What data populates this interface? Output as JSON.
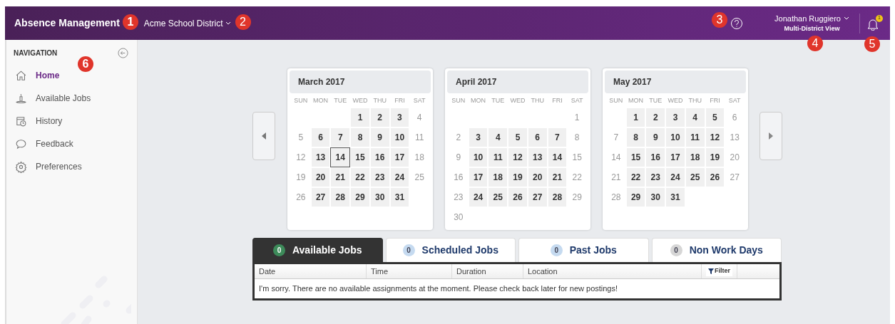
{
  "header": {
    "title": {
      "text": "Absence Management",
      "callout": "1"
    },
    "district": {
      "text": "Acme School District",
      "callout": "2"
    },
    "help": {
      "callout": "3"
    },
    "user": {
      "name": "Jonathan Ruggiero",
      "view": "Multi-District View",
      "callout": "4"
    },
    "notifications": {
      "count": "1",
      "callout": "5"
    }
  },
  "sidebar": {
    "heading": "NAVIGATION",
    "callout": "6",
    "items": [
      {
        "label": "Home",
        "kind": "home",
        "selected": true
      },
      {
        "label": "Available Jobs",
        "kind": "jobs",
        "selected": false
      },
      {
        "label": "History",
        "kind": "history",
        "selected": false
      },
      {
        "label": "Feedback",
        "kind": "feedback",
        "selected": false
      },
      {
        "label": "Preferences",
        "kind": "preferences",
        "selected": false
      }
    ]
  },
  "months": [
    {
      "title": "March 2017",
      "weekdays": [
        "SUN",
        "MON",
        "TUE",
        "WED",
        "THU",
        "FRI",
        "SAT"
      ],
      "weeks": [
        [
          {
            "kind": "blank"
          },
          {
            "kind": "blank"
          },
          {
            "kind": "blank"
          },
          {
            "day": "1",
            "kind": "workday"
          },
          {
            "day": "2",
            "kind": "workday"
          },
          {
            "day": "3",
            "kind": "workday"
          },
          {
            "day": "4",
            "kind": "weekend"
          }
        ],
        [
          {
            "day": "5",
            "kind": "weekend"
          },
          {
            "day": "6",
            "kind": "workday"
          },
          {
            "day": "7",
            "kind": "workday"
          },
          {
            "day": "8",
            "kind": "workday"
          },
          {
            "day": "9",
            "kind": "workday"
          },
          {
            "day": "10",
            "kind": "workday"
          },
          {
            "day": "11",
            "kind": "weekend"
          }
        ],
        [
          {
            "day": "12",
            "kind": "weekend"
          },
          {
            "day": "13",
            "kind": "workday"
          },
          {
            "day": "14",
            "kind": "today"
          },
          {
            "day": "15",
            "kind": "workday"
          },
          {
            "day": "16",
            "kind": "workday"
          },
          {
            "day": "17",
            "kind": "workday"
          },
          {
            "day": "18",
            "kind": "weekend"
          }
        ],
        [
          {
            "day": "19",
            "kind": "weekend"
          },
          {
            "day": "20",
            "kind": "workday"
          },
          {
            "day": "21",
            "kind": "workday"
          },
          {
            "day": "22",
            "kind": "workday"
          },
          {
            "day": "23",
            "kind": "workday"
          },
          {
            "day": "24",
            "kind": "workday"
          },
          {
            "day": "25",
            "kind": "weekend"
          }
        ],
        [
          {
            "day": "26",
            "kind": "weekend"
          },
          {
            "day": "27",
            "kind": "workday"
          },
          {
            "day": "28",
            "kind": "workday"
          },
          {
            "day": "29",
            "kind": "workday"
          },
          {
            "day": "30",
            "kind": "workday"
          },
          {
            "day": "31",
            "kind": "workday"
          },
          {
            "kind": "blank"
          }
        ]
      ]
    },
    {
      "title": "April 2017",
      "weekdays": [
        "SUN",
        "MON",
        "TUE",
        "WED",
        "THU",
        "FRI",
        "SAT"
      ],
      "weeks": [
        [
          {
            "kind": "blank"
          },
          {
            "kind": "blank"
          },
          {
            "kind": "blank"
          },
          {
            "kind": "blank"
          },
          {
            "kind": "blank"
          },
          {
            "kind": "blank"
          },
          {
            "day": "1",
            "kind": "weekend"
          }
        ],
        [
          {
            "day": "2",
            "kind": "weekend"
          },
          {
            "day": "3",
            "kind": "workday"
          },
          {
            "day": "4",
            "kind": "workday"
          },
          {
            "day": "5",
            "kind": "workday"
          },
          {
            "day": "6",
            "kind": "workday"
          },
          {
            "day": "7",
            "kind": "workday"
          },
          {
            "day": "8",
            "kind": "weekend"
          }
        ],
        [
          {
            "day": "9",
            "kind": "weekend"
          },
          {
            "day": "10",
            "kind": "workday"
          },
          {
            "day": "11",
            "kind": "workday"
          },
          {
            "day": "12",
            "kind": "workday"
          },
          {
            "day": "13",
            "kind": "workday"
          },
          {
            "day": "14",
            "kind": "workday"
          },
          {
            "day": "15",
            "kind": "weekend"
          }
        ],
        [
          {
            "day": "16",
            "kind": "weekend"
          },
          {
            "day": "17",
            "kind": "workday"
          },
          {
            "day": "18",
            "kind": "workday"
          },
          {
            "day": "19",
            "kind": "workday"
          },
          {
            "day": "20",
            "kind": "workday"
          },
          {
            "day": "21",
            "kind": "workday"
          },
          {
            "day": "22",
            "kind": "weekend"
          }
        ],
        [
          {
            "day": "23",
            "kind": "weekend"
          },
          {
            "day": "24",
            "kind": "workday"
          },
          {
            "day": "25",
            "kind": "workday"
          },
          {
            "day": "26",
            "kind": "workday"
          },
          {
            "day": "27",
            "kind": "workday"
          },
          {
            "day": "28",
            "kind": "workday"
          },
          {
            "day": "29",
            "kind": "weekend"
          }
        ],
        [
          {
            "day": "30",
            "kind": "weekend"
          },
          {
            "kind": "blank"
          },
          {
            "kind": "blank"
          },
          {
            "kind": "blank"
          },
          {
            "kind": "blank"
          },
          {
            "kind": "blank"
          },
          {
            "kind": "blank"
          }
        ]
      ]
    },
    {
      "title": "May 2017",
      "weekdays": [
        "SUN",
        "MON",
        "TUE",
        "WED",
        "THU",
        "FRI",
        "SAT"
      ],
      "weeks": [
        [
          {
            "kind": "blank"
          },
          {
            "day": "1",
            "kind": "workday"
          },
          {
            "day": "2",
            "kind": "workday"
          },
          {
            "day": "3",
            "kind": "workday"
          },
          {
            "day": "4",
            "kind": "workday"
          },
          {
            "day": "5",
            "kind": "workday"
          },
          {
            "day": "6",
            "kind": "weekend"
          }
        ],
        [
          {
            "day": "7",
            "kind": "weekend"
          },
          {
            "day": "8",
            "kind": "workday"
          },
          {
            "day": "9",
            "kind": "workday"
          },
          {
            "day": "10",
            "kind": "workday"
          },
          {
            "day": "11",
            "kind": "workday"
          },
          {
            "day": "12",
            "kind": "workday"
          },
          {
            "day": "13",
            "kind": "weekend"
          }
        ],
        [
          {
            "day": "14",
            "kind": "weekend"
          },
          {
            "day": "15",
            "kind": "workday"
          },
          {
            "day": "16",
            "kind": "workday"
          },
          {
            "day": "17",
            "kind": "workday"
          },
          {
            "day": "18",
            "kind": "workday"
          },
          {
            "day": "19",
            "kind": "workday"
          },
          {
            "day": "20",
            "kind": "weekend"
          }
        ],
        [
          {
            "day": "21",
            "kind": "weekend"
          },
          {
            "day": "22",
            "kind": "workday"
          },
          {
            "day": "23",
            "kind": "workday"
          },
          {
            "day": "24",
            "kind": "workday"
          },
          {
            "day": "25",
            "kind": "workday"
          },
          {
            "day": "26",
            "kind": "workday"
          },
          {
            "day": "27",
            "kind": "weekend"
          }
        ],
        [
          {
            "day": "28",
            "kind": "weekend"
          },
          {
            "day": "29",
            "kind": "workday"
          },
          {
            "day": "30",
            "kind": "workday"
          },
          {
            "day": "31",
            "kind": "workday"
          },
          {
            "kind": "blank"
          },
          {
            "kind": "blank"
          },
          {
            "kind": "blank"
          }
        ]
      ]
    }
  ],
  "tabs": [
    {
      "label": "Available Jobs",
      "count": "0",
      "color": "#3d8b5a",
      "selected": true
    },
    {
      "label": "Scheduled Jobs",
      "count": "0",
      "color": "#c5daf0",
      "selected": false
    },
    {
      "label": "Past Jobs",
      "count": "0",
      "color": "#c5daf0",
      "selected": false
    },
    {
      "label": "Non Work Days",
      "count": "0",
      "color": "#d6d6d6",
      "selected": false
    }
  ],
  "table": {
    "columns": [
      "Date",
      "Time",
      "Duration",
      "Location"
    ],
    "filter": "Filter",
    "message": "I'm sorry. There are no available assignments at the moment. Please check back later for new postings!"
  }
}
